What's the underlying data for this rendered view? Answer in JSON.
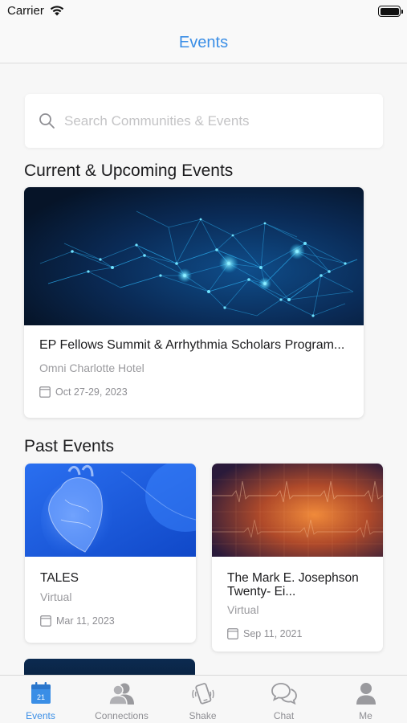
{
  "status_bar": {
    "carrier": "Carrier"
  },
  "nav": {
    "title": "Events"
  },
  "search": {
    "placeholder": "Search Communities & Events"
  },
  "sections": {
    "upcoming": "Current & Upcoming Events",
    "past": "Past Events"
  },
  "featured_event": {
    "title": "EP Fellows Summit & Arrhythmia Scholars Program...",
    "location": "Omni Charlotte Hotel",
    "date": "Oct 27-29, 2023",
    "image": "blue-network-mesh"
  },
  "past_events": [
    {
      "title": "TALES",
      "location": "Virtual",
      "date": "Mar 11, 2023",
      "image": "blue-heart-illustration"
    },
    {
      "title": "The Mark E. Josephson Twenty- Ei...",
      "location": "Virtual",
      "date": "Sep 11, 2021",
      "image": "orange-ecg-grid"
    }
  ],
  "tabs": [
    {
      "label": "Events",
      "icon": "calendar-icon",
      "badge": "21",
      "active": true
    },
    {
      "label": "Connections",
      "icon": "people-icon",
      "active": false
    },
    {
      "label": "Shake",
      "icon": "phone-shake-icon",
      "active": false
    },
    {
      "label": "Chat",
      "icon": "chat-bubbles-icon",
      "active": false
    },
    {
      "label": "Me",
      "icon": "person-icon",
      "active": false
    }
  ],
  "colors": {
    "accent": "#3a8ee6",
    "muted": "#8e8e93"
  }
}
